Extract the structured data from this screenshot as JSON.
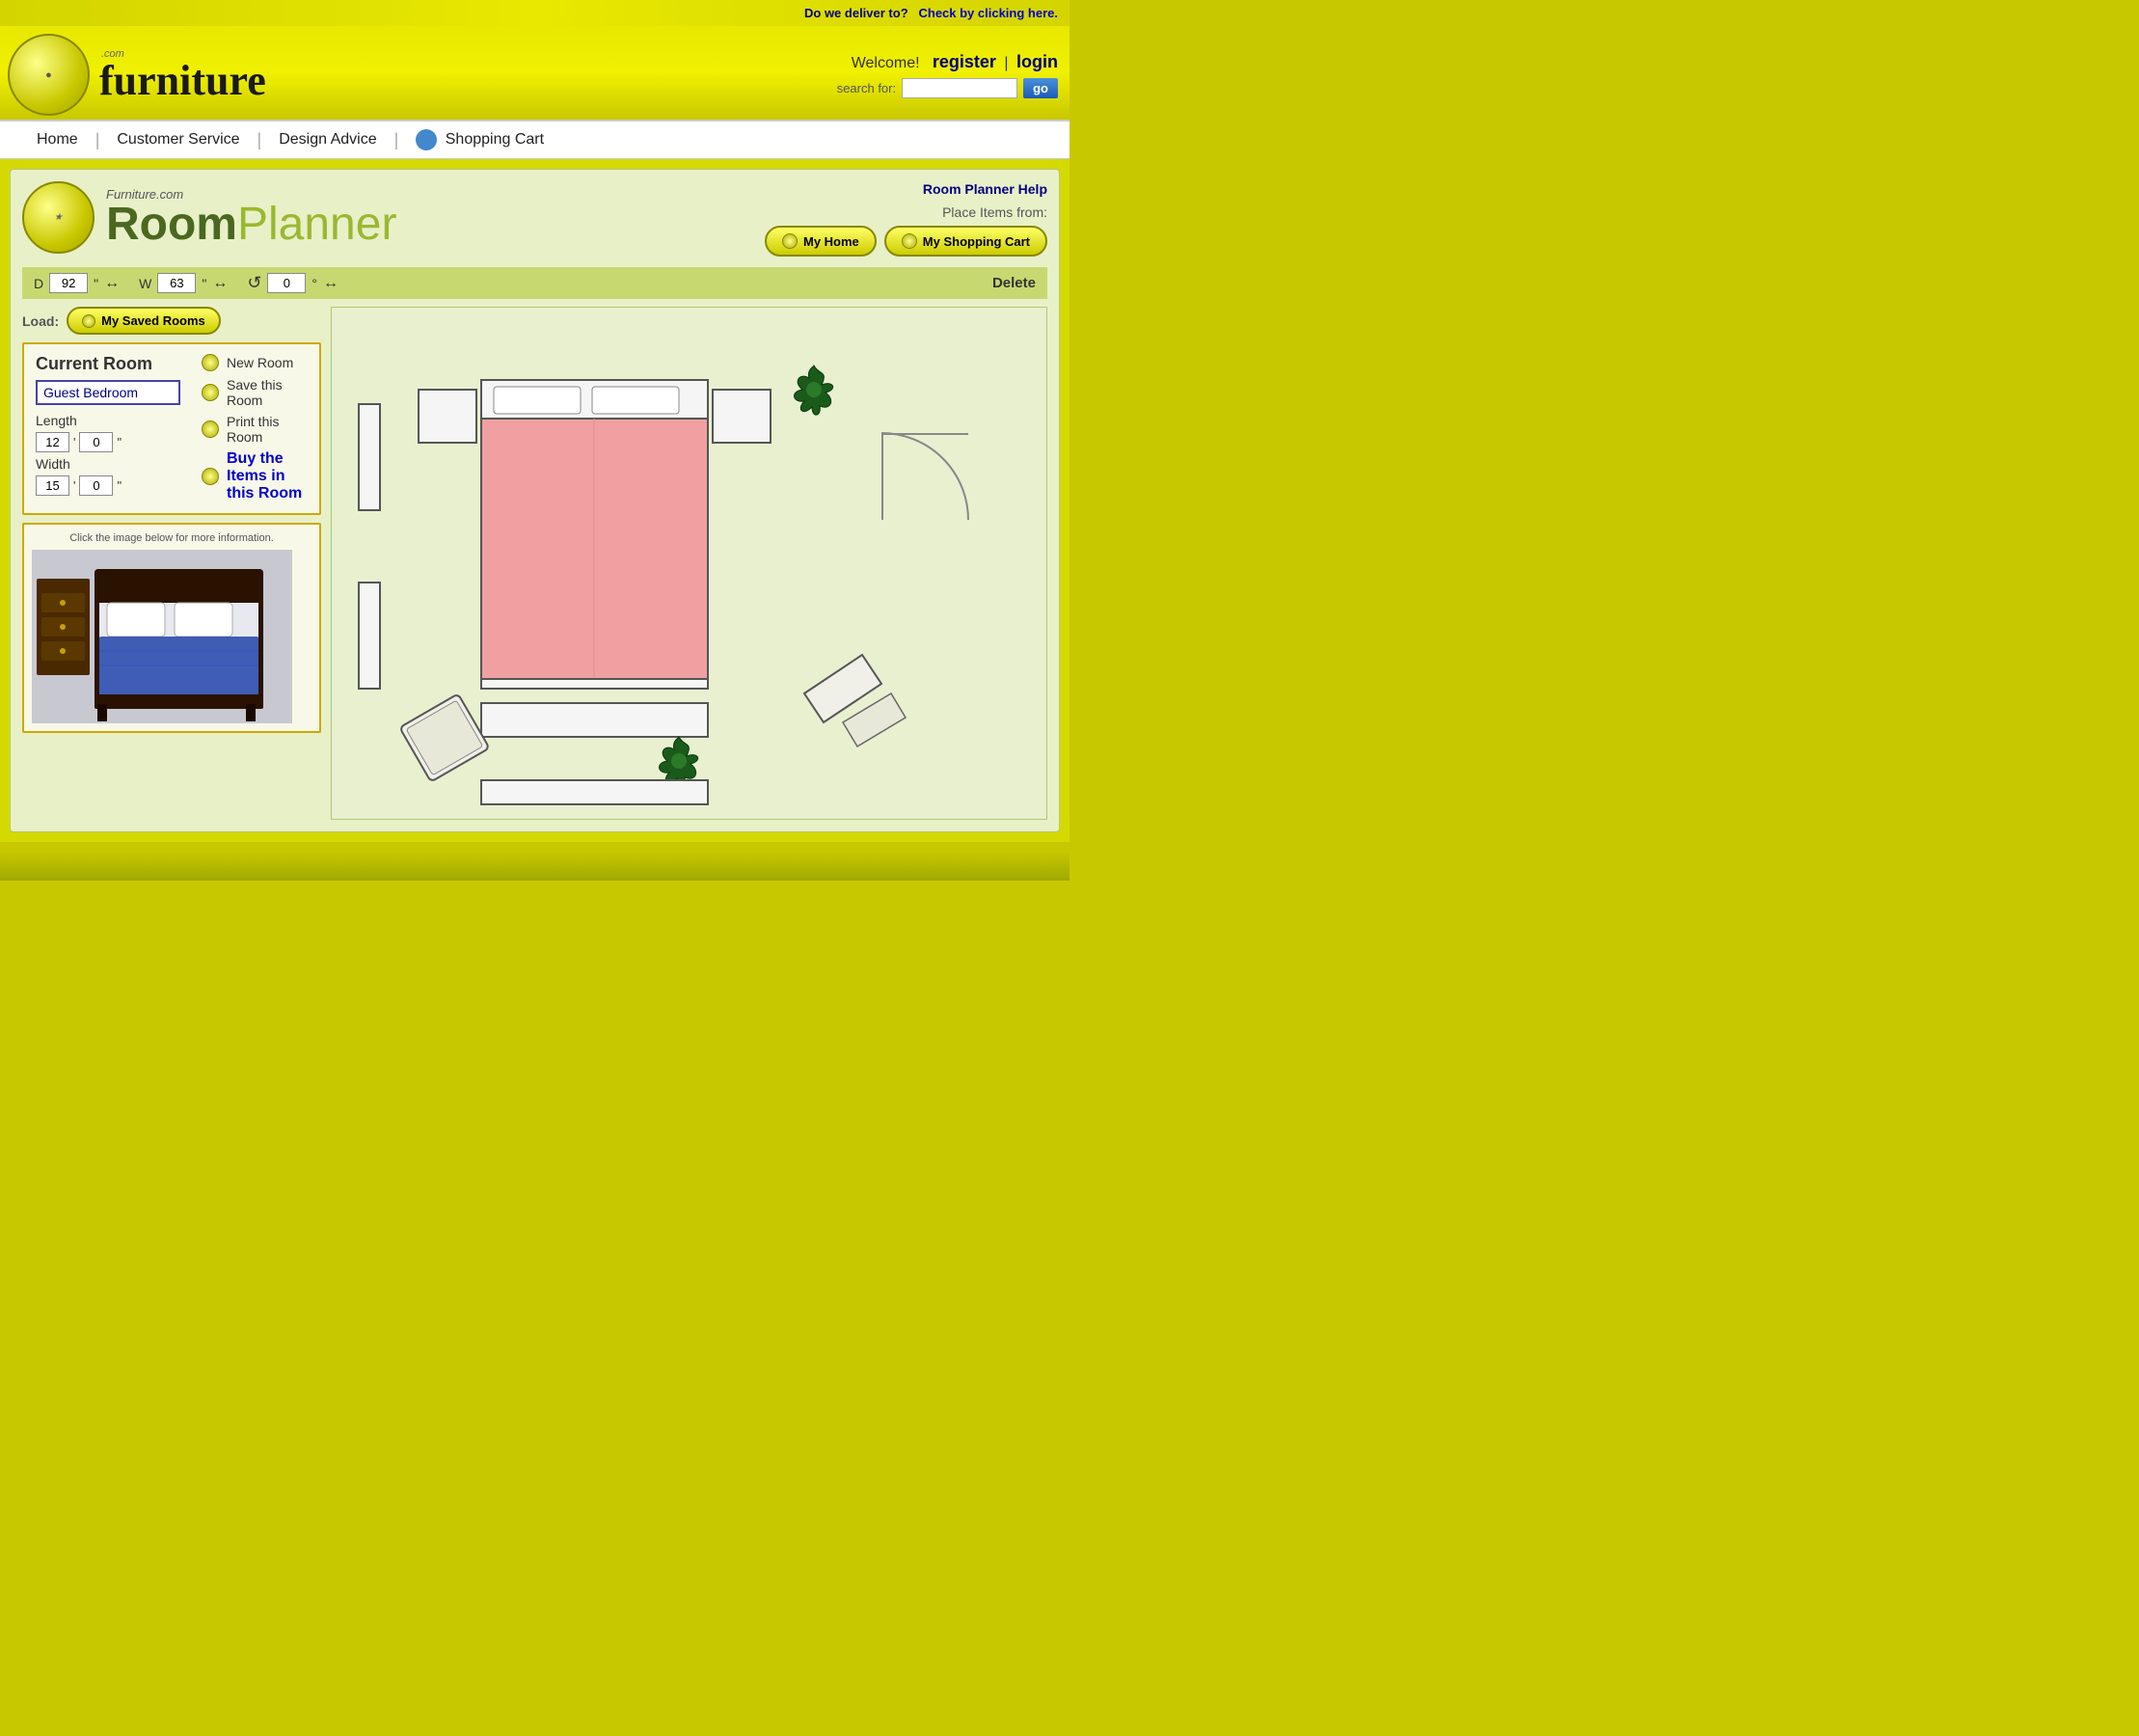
{
  "delivery_bar": {
    "label": "Do we deliver to?",
    "link_text": "Check by clicking here."
  },
  "header": {
    "logo_com": ".com",
    "logo_main": "furniture",
    "welcome_text": "Welcome!",
    "register_label": "register",
    "login_label": "login",
    "sep": "|",
    "search_label": "search for:",
    "search_placeholder": "",
    "go_label": "go"
  },
  "navbar": {
    "items": [
      {
        "label": "Home",
        "id": "home"
      },
      {
        "label": "Customer Service",
        "id": "customer-service"
      },
      {
        "label": "Design Advice",
        "id": "design-advice"
      },
      {
        "label": "Shopping Cart",
        "id": "shopping-cart"
      }
    ]
  },
  "room_planner": {
    "help_link": "Room Planner Help",
    "logo_top": "Furniture.com",
    "logo_room": "Room",
    "logo_planner": "Planner",
    "place_items_label": "Place Items from:",
    "my_home_btn": "My Home",
    "my_shopping_cart_btn": "My Shopping Cart",
    "tools": {
      "d_label": "D",
      "d_value": "92",
      "d_unit": "\"",
      "w_label": "W",
      "w_value": "63",
      "w_unit": "\"",
      "rotate_value": "0",
      "rotate_unit": "°",
      "delete_label": "Delete"
    },
    "load_label": "Load:",
    "my_saved_rooms_btn": "My Saved Rooms",
    "current_room": {
      "title": "Current Room",
      "room_name": "Guest Bedroom",
      "length_label": "Length",
      "length_ft": "12",
      "length_in": "0",
      "width_label": "Width",
      "width_ft": "15",
      "width_in": "0",
      "actions": [
        {
          "label": "New Room",
          "id": "new-room"
        },
        {
          "label": "Save this Room",
          "id": "save-room"
        },
        {
          "label": "Print this Room",
          "id": "print-room"
        },
        {
          "label": "Buy the Items in this Room",
          "id": "buy-items",
          "style": "blue-bold"
        }
      ]
    },
    "preview": {
      "caption": "Click the image below for more information."
    }
  }
}
